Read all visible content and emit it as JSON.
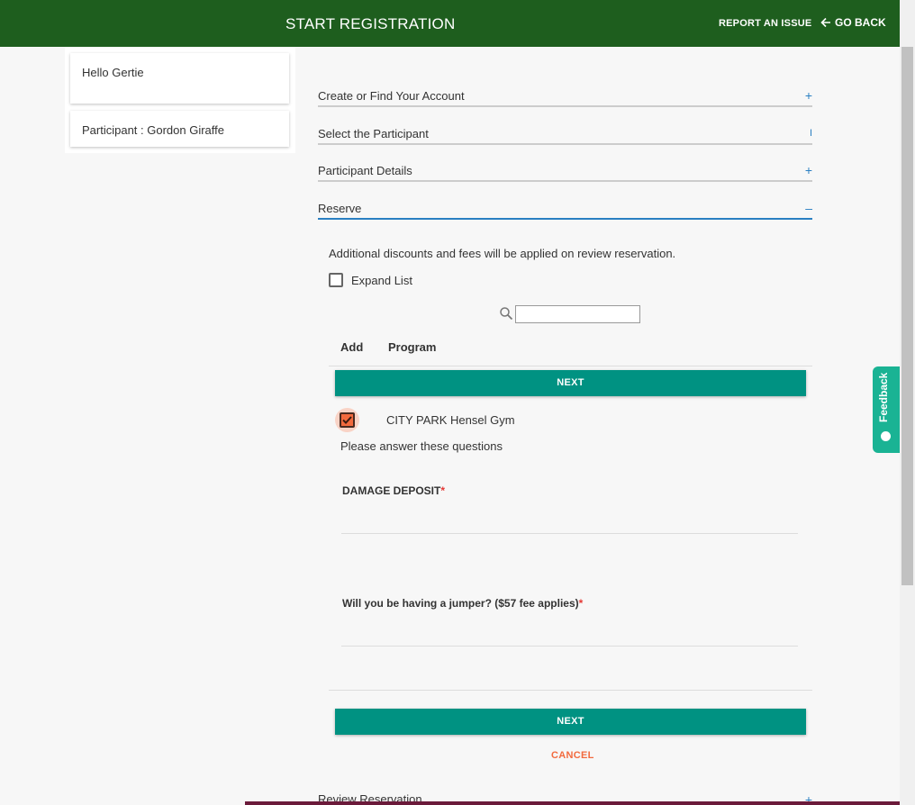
{
  "header": {
    "title": "START REGISTRATION",
    "report_label": "REPORT AN ISSUE",
    "goback_label": "GO BACK"
  },
  "sidebar": {
    "greeting": "Hello Gertie",
    "participant": "Participant : Gordon Giraffe"
  },
  "steps": [
    {
      "label": "Create or Find Your Account",
      "icon": "+"
    },
    {
      "label": "Select the Participant",
      "icon": "I"
    },
    {
      "label": "Participant Details",
      "icon": "+"
    },
    {
      "label": "Reserve",
      "icon": "–"
    }
  ],
  "reserve": {
    "note": "Additional discounts and fees will be applied on review reservation.",
    "expand_label": "Expand List",
    "search_value": "",
    "col_add": "Add",
    "col_program": "Program",
    "next_label": "NEXT",
    "program_name": "CITY PARK Hensel Gym",
    "questions_intro": "Please answer these questions",
    "question1": "DAMAGE DEPOSIT",
    "question2": "Will you be having a jumper? ($57 fee applies)",
    "required_mark": "*",
    "next_label_bottom": "NEXT",
    "cancel_label": "CANCEL"
  },
  "review": {
    "label": "Review Reservation",
    "icon": "+"
  },
  "feedback": {
    "label": "Feedback"
  },
  "colors": {
    "header": "#1e5e1e",
    "primary_button": "#009282",
    "accent": "#2a7fc2",
    "cancel": "#f26a3e",
    "feedback": "#1ab394"
  }
}
